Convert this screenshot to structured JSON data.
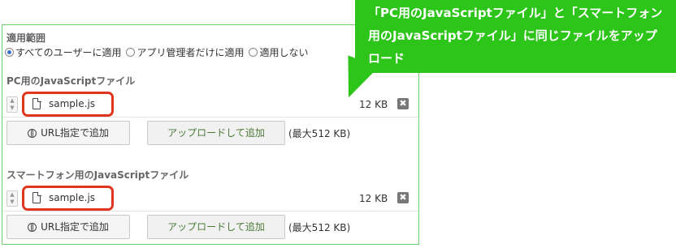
{
  "callout": {
    "text": "「PC用のJavaScriptファイル」と「スマートフォン用のJavaScriptファイル」に同じファイルをアップロード"
  },
  "scope": {
    "title": "適用範囲",
    "options": [
      {
        "label": "すべてのユーザーに適用",
        "checked": true
      },
      {
        "label": "アプリ管理者だけに適用",
        "checked": false
      },
      {
        "label": "適用しない",
        "checked": false
      }
    ]
  },
  "pc": {
    "title": "PC用のJavaScriptファイル",
    "file": {
      "name": "sample.js",
      "size": "12 KB",
      "remove": "✖"
    },
    "url_button": "URL指定で追加",
    "upload_button": "アップロードして追加",
    "max_size": "(最大512 KB)"
  },
  "sp": {
    "title": "スマートフォン用のJavaScriptファイル",
    "file": {
      "name": "sample.js",
      "size": "12 KB",
      "remove": "✖"
    },
    "url_button": "URL指定で追加",
    "upload_button": "アップロードして追加",
    "max_size": "(最大512 KB)"
  },
  "colors": {
    "accent_green": "#2ec51a",
    "highlight_red": "#e0361f",
    "panel_border": "#6fd06f"
  }
}
